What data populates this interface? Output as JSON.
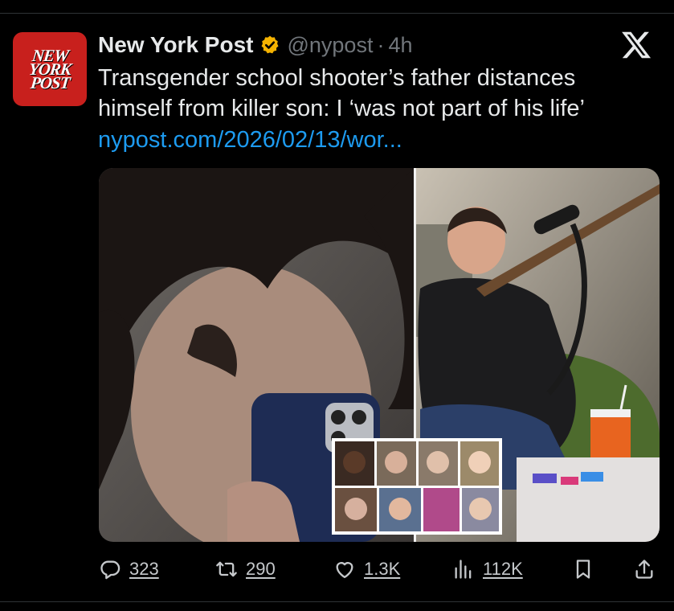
{
  "post": {
    "author": {
      "display_name": "New York Post",
      "handle": "@nypost",
      "separator": "·",
      "time": "4h",
      "avatar_text": [
        "NEW",
        "YORK",
        "POST"
      ],
      "verified": true,
      "verified_color": "#f5b301"
    },
    "text_lines": [
      "Transgender school shooter’s father distances",
      "himself from killer son: I ‘was not part of his life’"
    ],
    "link": "nypost.com/2026/02/13/wor..."
  },
  "actions": {
    "replies": "323",
    "reposts": "290",
    "likes": "1.3K",
    "views": "112K"
  },
  "icons": {
    "platform": "x-logo-icon",
    "reply": "reply-icon",
    "repost": "repost-icon",
    "like": "heart-icon",
    "views": "views-chart-icon",
    "bookmark": "bookmark-icon",
    "share": "share-icon"
  },
  "colors": {
    "background": "#000000",
    "text": "#e7e9ea",
    "muted": "#71767b",
    "link": "#1d9bf0",
    "brand": "#c8201d"
  }
}
